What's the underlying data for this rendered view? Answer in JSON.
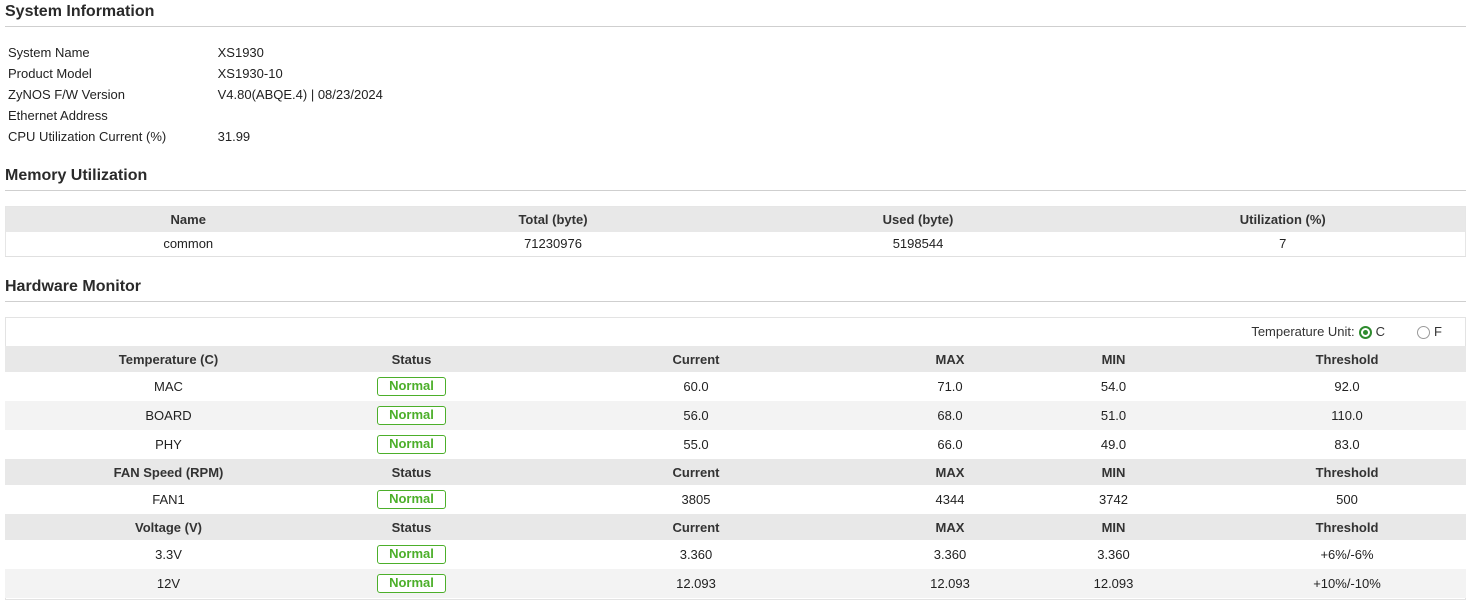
{
  "system_info": {
    "title": "System Information",
    "rows": [
      {
        "label": "System Name",
        "value": "XS1930"
      },
      {
        "label": "Product Model",
        "value": "XS1930-10"
      },
      {
        "label": "ZyNOS F/W Version",
        "value": "V4.80(ABQE.4) | 08/23/2024"
      },
      {
        "label": "Ethernet Address",
        "value": ""
      },
      {
        "label": "CPU Utilization Current (%)",
        "value": "31.99"
      }
    ]
  },
  "memory": {
    "title": "Memory Utilization",
    "headers": [
      "Name",
      "Total (byte)",
      "Used (byte)",
      "Utilization (%)"
    ],
    "rows": [
      [
        "common",
        "71230976",
        "5198544",
        "7"
      ]
    ]
  },
  "hardware": {
    "title": "Hardware Monitor",
    "unit_label": "Temperature Unit:",
    "unit_options": [
      {
        "label": "C",
        "selected": true
      },
      {
        "label": "F",
        "selected": false
      }
    ],
    "status_color": "#4caf2a",
    "groups": [
      {
        "headers": [
          "Temperature (C)",
          "Status",
          "Current",
          "MAX",
          "MIN",
          "Threshold"
        ],
        "rows": [
          {
            "name": "MAC",
            "status": "Normal",
            "current": "60.0",
            "max": "71.0",
            "min": "54.0",
            "threshold": "92.0"
          },
          {
            "name": "BOARD",
            "status": "Normal",
            "current": "56.0",
            "max": "68.0",
            "min": "51.0",
            "threshold": "110.0"
          },
          {
            "name": "PHY",
            "status": "Normal",
            "current": "55.0",
            "max": "66.0",
            "min": "49.0",
            "threshold": "83.0"
          }
        ]
      },
      {
        "headers": [
          "FAN Speed (RPM)",
          "Status",
          "Current",
          "MAX",
          "MIN",
          "Threshold"
        ],
        "rows": [
          {
            "name": "FAN1",
            "status": "Normal",
            "current": "3805",
            "max": "4344",
            "min": "3742",
            "threshold": "500"
          }
        ]
      },
      {
        "headers": [
          "Voltage (V)",
          "Status",
          "Current",
          "MAX",
          "MIN",
          "Threshold"
        ],
        "rows": [
          {
            "name": "3.3V",
            "status": "Normal",
            "current": "3.360",
            "max": "3.360",
            "min": "3.360",
            "threshold": "+6%/-6%"
          },
          {
            "name": "12V",
            "status": "Normal",
            "current": "12.093",
            "max": "12.093",
            "min": "12.093",
            "threshold": "+10%/-10%"
          }
        ]
      }
    ]
  }
}
